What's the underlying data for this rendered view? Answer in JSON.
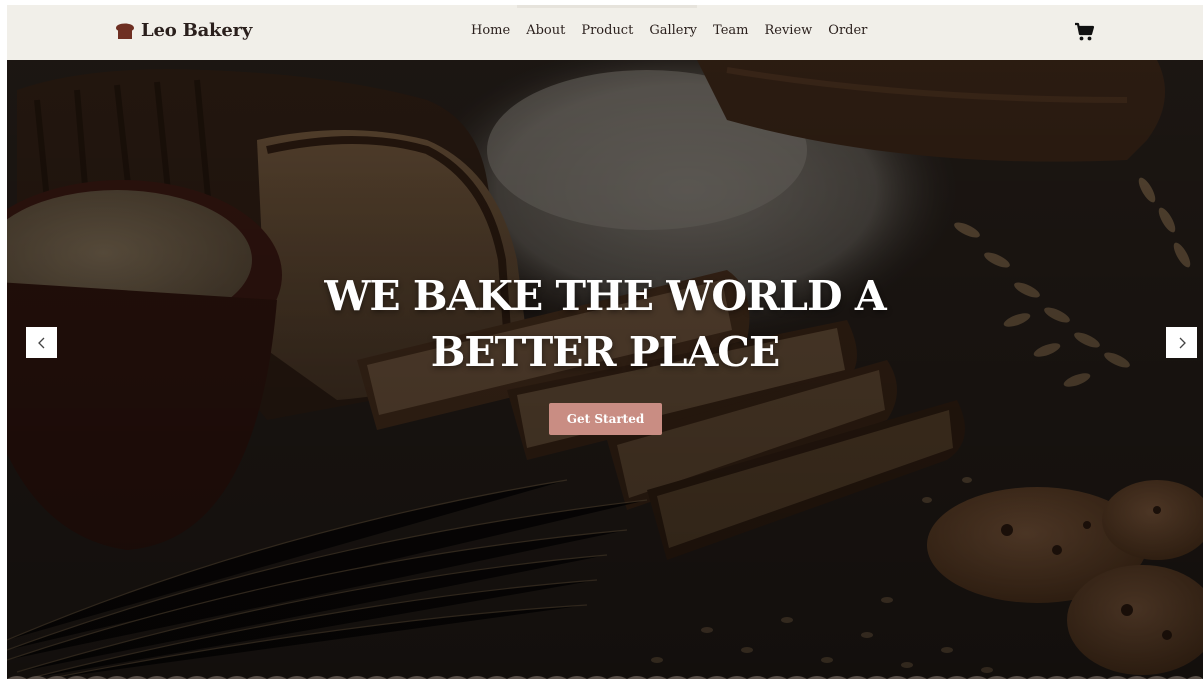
{
  "brand": {
    "name": "Leo Bakery",
    "icon": "bread-icon",
    "color": "#6e2f22"
  },
  "nav": {
    "items": [
      {
        "label": "Home"
      },
      {
        "label": "About"
      },
      {
        "label": "Product"
      },
      {
        "label": "Gallery"
      },
      {
        "label": "Team"
      },
      {
        "label": "Review"
      },
      {
        "label": "Order"
      }
    ],
    "cart_icon": "shopping-cart-icon"
  },
  "hero": {
    "title_line1": "WE BAKE THE WORLD A",
    "title_line2": "BETTER PLACE",
    "cta_label": "Get Started",
    "prev_icon": "chevron-left-icon",
    "next_icon": "chevron-right-icon"
  },
  "colors": {
    "nav_bg": "#f1efe9",
    "accent": "#c98d83",
    "text_dark": "#2a1f1c",
    "brand_icon": "#6e2f22"
  }
}
